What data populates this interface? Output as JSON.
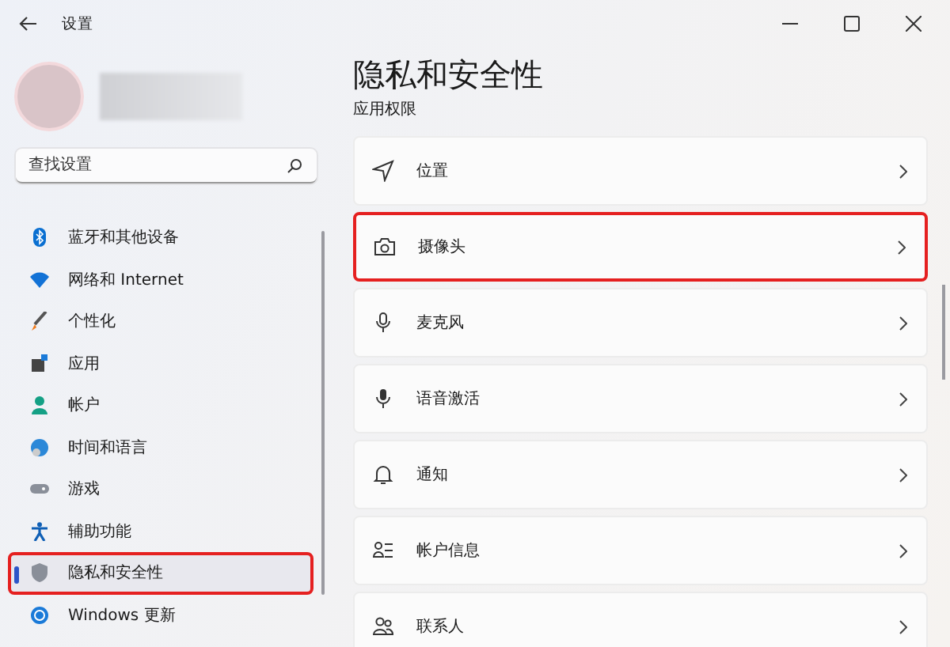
{
  "window": {
    "title": "设置"
  },
  "search": {
    "placeholder": "查找设置"
  },
  "sidebar": {
    "items": [
      {
        "label": "蓝牙和其他设备",
        "selected": false,
        "highlighted": false
      },
      {
        "label": "网络和 Internet",
        "selected": false,
        "highlighted": false
      },
      {
        "label": "个性化",
        "selected": false,
        "highlighted": false
      },
      {
        "label": "应用",
        "selected": false,
        "highlighted": false
      },
      {
        "label": "帐户",
        "selected": false,
        "highlighted": false
      },
      {
        "label": "时间和语言",
        "selected": false,
        "highlighted": false
      },
      {
        "label": "游戏",
        "selected": false,
        "highlighted": false
      },
      {
        "label": "辅助功能",
        "selected": false,
        "highlighted": false
      },
      {
        "label": "隐私和安全性",
        "selected": true,
        "highlighted": true
      },
      {
        "label": "Windows 更新",
        "selected": false,
        "highlighted": false
      }
    ]
  },
  "page": {
    "title": "隐私和安全性",
    "subtitle": "应用权限"
  },
  "settings": [
    {
      "label": "位置",
      "highlighted": false
    },
    {
      "label": "摄像头",
      "highlighted": true
    },
    {
      "label": "麦克风",
      "highlighted": false
    },
    {
      "label": "语音激活",
      "highlighted": false
    },
    {
      "label": "通知",
      "highlighted": false
    },
    {
      "label": "帐户信息",
      "highlighted": false
    },
    {
      "label": "联系人",
      "highlighted": false
    }
  ]
}
